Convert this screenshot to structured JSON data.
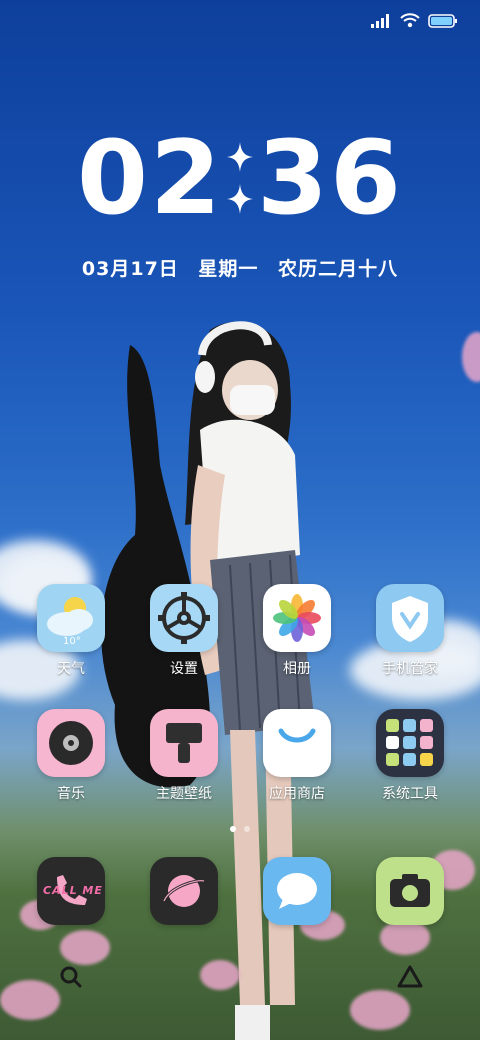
{
  "status_bar": {
    "signal_icon": "signal-icon",
    "wifi_icon": "wifi-icon",
    "battery_icon": "battery-icon"
  },
  "clock": {
    "hour": "02",
    "minute": "36"
  },
  "date": {
    "day": "03月17日",
    "weekday": "星期一",
    "lunar": "农历二月十八"
  },
  "weather_temp": "10°",
  "apps_row1": [
    {
      "label": "天气",
      "icon": "weather-icon"
    },
    {
      "label": "设置",
      "icon": "settings-gear-icon"
    },
    {
      "label": "相册",
      "icon": "photos-icon"
    },
    {
      "label": "手机管家",
      "icon": "security-shield-icon"
    }
  ],
  "apps_row2": [
    {
      "label": "音乐",
      "icon": "music-record-icon"
    },
    {
      "label": "主题壁纸",
      "icon": "theme-brush-icon"
    },
    {
      "label": "应用商店",
      "icon": "app-store-icon"
    },
    {
      "label": "系统工具",
      "icon": "system-tools-folder-icon"
    }
  ],
  "dock": {
    "phone_text": "CALL ME"
  },
  "pages": {
    "current": 1,
    "total": 2
  }
}
